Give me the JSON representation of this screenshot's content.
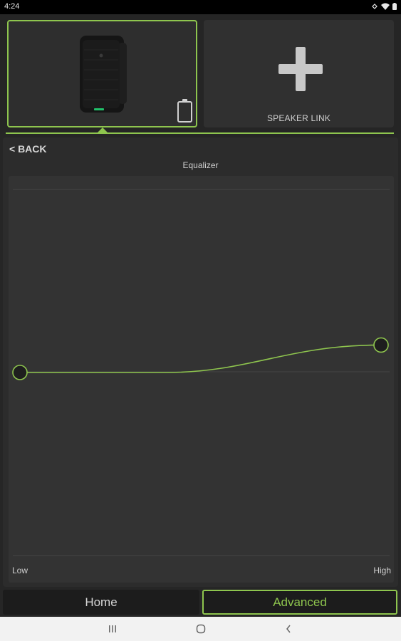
{
  "status": {
    "time": "4:24"
  },
  "speaker_link": {
    "label": "SPEAKER LINK"
  },
  "panel": {
    "back_label": "< BACK",
    "title": "Equalizer"
  },
  "equalizer": {
    "low_label": "Low",
    "high_label": "High",
    "low_handle_level": 0.5,
    "high_handle_level": 0.575
  },
  "tabs": {
    "home": "Home",
    "advanced": "Advanced",
    "active": "advanced"
  },
  "colors": {
    "accent": "#8ec54e",
    "background": "#262626",
    "panel": "#2c2c2c"
  },
  "icons": [
    "wifi-icon",
    "battery-status-icon",
    "speaker-image",
    "battery-icon",
    "plus-icon",
    "nav-recents-icon",
    "nav-home-icon",
    "nav-back-icon"
  ]
}
